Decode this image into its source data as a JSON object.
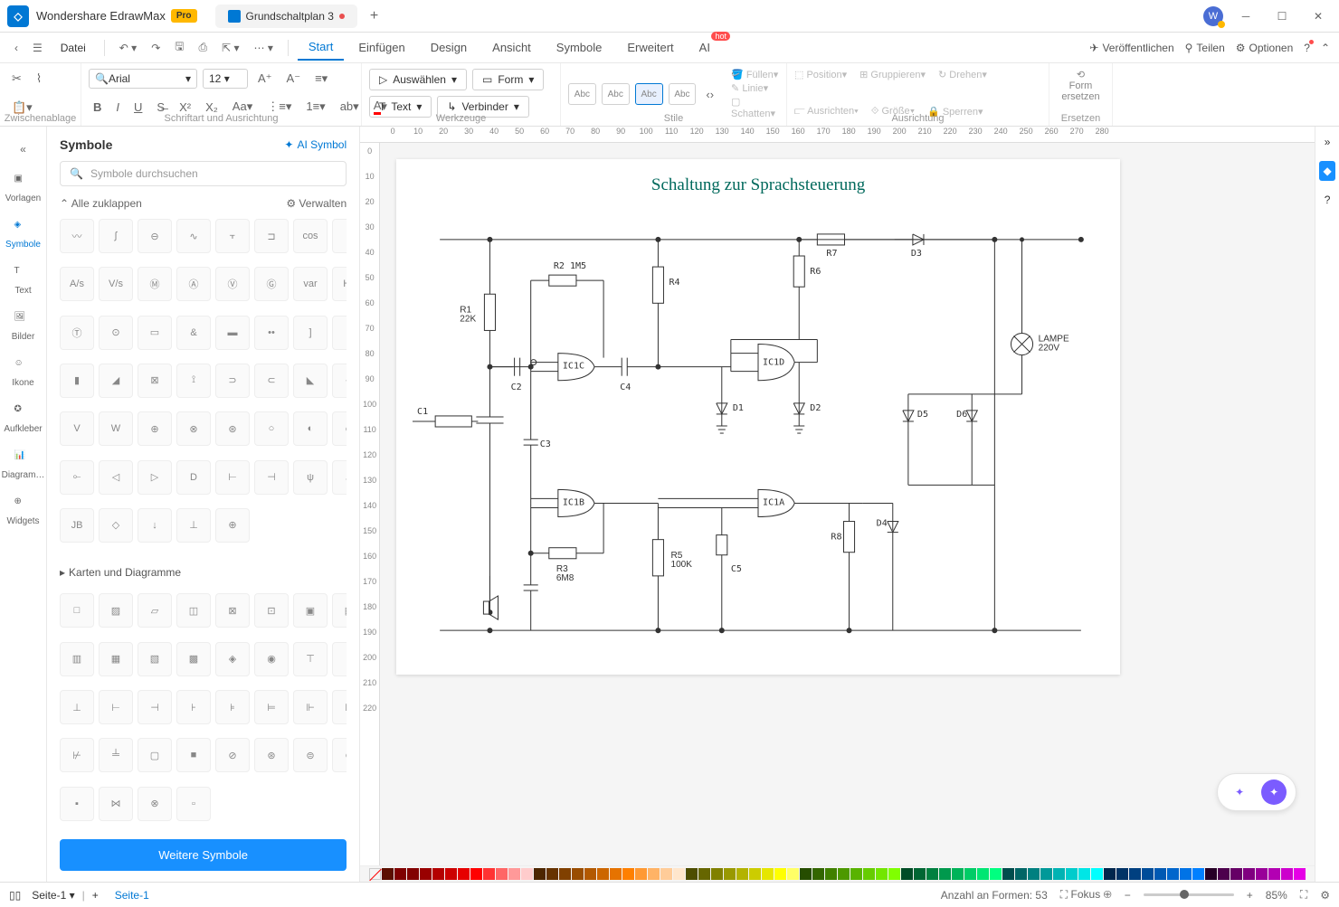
{
  "app": {
    "name": "Wondershare EdrawMax",
    "badge": "Pro"
  },
  "tabs": {
    "active": "Grundschaltplan 3"
  },
  "menubar": {
    "file": "Datei"
  },
  "menuTabs": {
    "start": "Start",
    "einfugen": "Einfügen",
    "design": "Design",
    "ansicht": "Ansicht",
    "symbole": "Symbole",
    "erweitert": "Erweitert",
    "ai": "AI",
    "hot": "hot"
  },
  "menuRight": {
    "publish": "Veröffentlichen",
    "share": "Teilen",
    "options": "Optionen"
  },
  "ribbon": {
    "clipboard": "Zwischenablage",
    "font": "Schriftart und Ausrichtung",
    "tools": "Werkzeuge",
    "styles": "Stile",
    "align": "Ausrichtung",
    "replace": "Ersetzen",
    "fontName": "Arial",
    "fontSize": "12",
    "select": "Auswählen",
    "form": "Form",
    "text": "Text",
    "connector": "Verbinder",
    "abc": "Abc",
    "fill": "Füllen",
    "line": "Linie",
    "shadow": "Schatten",
    "position": "Position",
    "alignBtn": "Ausrichten",
    "group": "Gruppieren",
    "size": "Größe",
    "rotate": "Drehen",
    "lock": "Sperren",
    "replaceForm": "Form\nersetzen"
  },
  "leftbar": {
    "vorlagen": "Vorlagen",
    "symbole": "Symbole",
    "text": "Text",
    "bilder": "Bilder",
    "ikone": "Ikone",
    "aufkleber": "Aufkleber",
    "diagram": "Diagram…",
    "widgets": "Widgets"
  },
  "symbolsPanel": {
    "title": "Symbole",
    "ai": "AI Symbol",
    "searchPh": "Symbole durchsuchen",
    "collapseAll": "Alle zuklappen",
    "manage": "Verwalten",
    "section": "Karten und Diagramme",
    "more": "Weitere Symbole"
  },
  "canvas": {
    "title": "Schaltung zur Sprachsteuerung",
    "labels": {
      "R1": "R1\n22K",
      "R2": "R2 1M5",
      "R3": "R3\n6M8",
      "R4": "R4",
      "R5": "R5\n100K",
      "R6": "R6",
      "R7": "R7",
      "R8": "R8",
      "C1": "C1",
      "C2": "C2",
      "C3": "C3",
      "C4": "C4",
      "C5": "C5",
      "D1": "D1",
      "D2": "D2",
      "D3": "D3",
      "D4": "D4",
      "D5": "D5",
      "D6": "D6",
      "IC1A": "IC1A",
      "IC1B": "IC1B",
      "IC1C": "IC1C",
      "IC1D": "IC1D",
      "LAMP": "LAMPE\n220V"
    }
  },
  "status": {
    "page": "Seite-1",
    "pageSel": "Seite-1",
    "shapes": "Anzahl an Formen: 53",
    "focus": "Fokus",
    "zoom": "85%"
  },
  "rulerH": [
    "0",
    "10",
    "20",
    "30",
    "40",
    "50",
    "60",
    "70",
    "80",
    "90",
    "100",
    "110",
    "120",
    "130",
    "140",
    "150",
    "160",
    "170",
    "180",
    "190",
    "200",
    "210",
    "220",
    "230",
    "240",
    "250",
    "260",
    "270",
    "280"
  ],
  "rulerV": [
    "0",
    "10",
    "20",
    "30",
    "40",
    "50",
    "60",
    "70",
    "80",
    "90",
    "100",
    "110",
    "120",
    "130",
    "140",
    "150",
    "160",
    "170",
    "180",
    "190",
    "200",
    "210",
    "220"
  ],
  "colors": [
    "#5b0f00",
    "#7f0000",
    "#820000",
    "#990000",
    "#b40000",
    "#cc0000",
    "#e60000",
    "#ff0000",
    "#ff3333",
    "#ff6666",
    "#ff9999",
    "#ffcccc",
    "#4d2600",
    "#663300",
    "#804000",
    "#994d00",
    "#b35900",
    "#cc6600",
    "#e67300",
    "#ff8000",
    "#ff9933",
    "#ffb366",
    "#ffcc99",
    "#ffe6cc",
    "#4d4d00",
    "#666600",
    "#808000",
    "#999900",
    "#b3b300",
    "#cccc00",
    "#e6e600",
    "#ffff00",
    "#ffff66",
    "#264d00",
    "#336600",
    "#408000",
    "#4d9900",
    "#59b300",
    "#66cc00",
    "#73e600",
    "#80ff00",
    "#004d26",
    "#006633",
    "#008040",
    "#00994d",
    "#00b359",
    "#00cc66",
    "#00e673",
    "#00ff80",
    "#004d4d",
    "#006666",
    "#008080",
    "#009999",
    "#00b3b3",
    "#00cccc",
    "#00e6e6",
    "#00ffff",
    "#00264d",
    "#003366",
    "#004080",
    "#004d99",
    "#0059b3",
    "#0066cc",
    "#0073e6",
    "#0080ff",
    "#260026",
    "#4d004d",
    "#660066",
    "#800080",
    "#990099",
    "#b300b3",
    "#cc00cc",
    "#e600e6"
  ]
}
